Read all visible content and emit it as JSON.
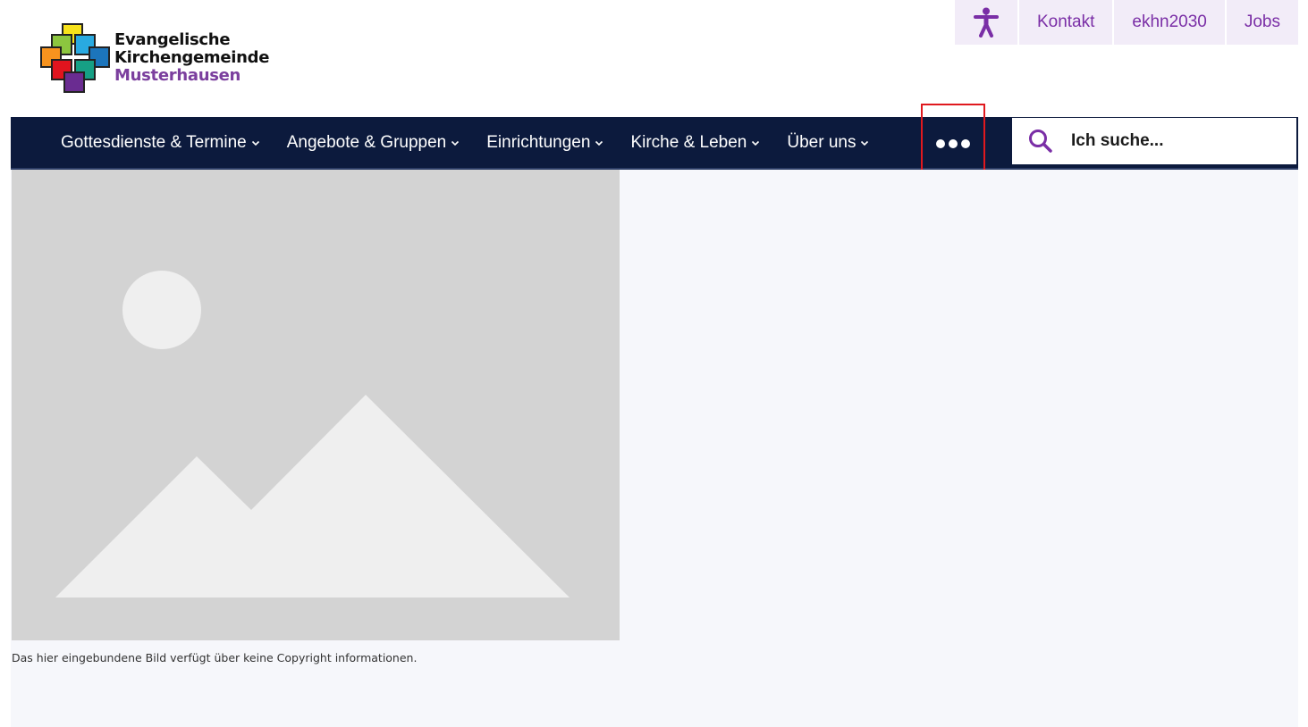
{
  "logo": {
    "line1": "Evangelische",
    "line2": "Kirchengemeinde",
    "line3": "Musterhausen"
  },
  "top_links": {
    "accessibility_icon": "accessibility-person-icon",
    "items": [
      {
        "label": "Kontakt"
      },
      {
        "label": "ekhn2030"
      },
      {
        "label": "Jobs"
      }
    ]
  },
  "nav": {
    "items": [
      {
        "label": "Gottesdienste & Termine"
      },
      {
        "label": "Angebote & Gruppen"
      },
      {
        "label": "Einrichtungen"
      },
      {
        "label": "Kirche & Leben"
      },
      {
        "label": "Über uns"
      }
    ],
    "more_icon": "ellipsis-icon",
    "chevron_icon": "chevron-down-icon"
  },
  "search": {
    "placeholder": "Ich suche...",
    "icon": "search-icon"
  },
  "content": {
    "image_icon": "image-placeholder-icon",
    "caption": "Das hier eingebundene Bild verfügt über keine Copyright informationen."
  },
  "colors": {
    "nav_bg": "#0c1a3d",
    "accent_purple": "#7a2ea6",
    "top_link_bg": "#f2ecf8",
    "highlight_red": "#e0191e",
    "placeholder_gray": "#d3d3d3"
  }
}
